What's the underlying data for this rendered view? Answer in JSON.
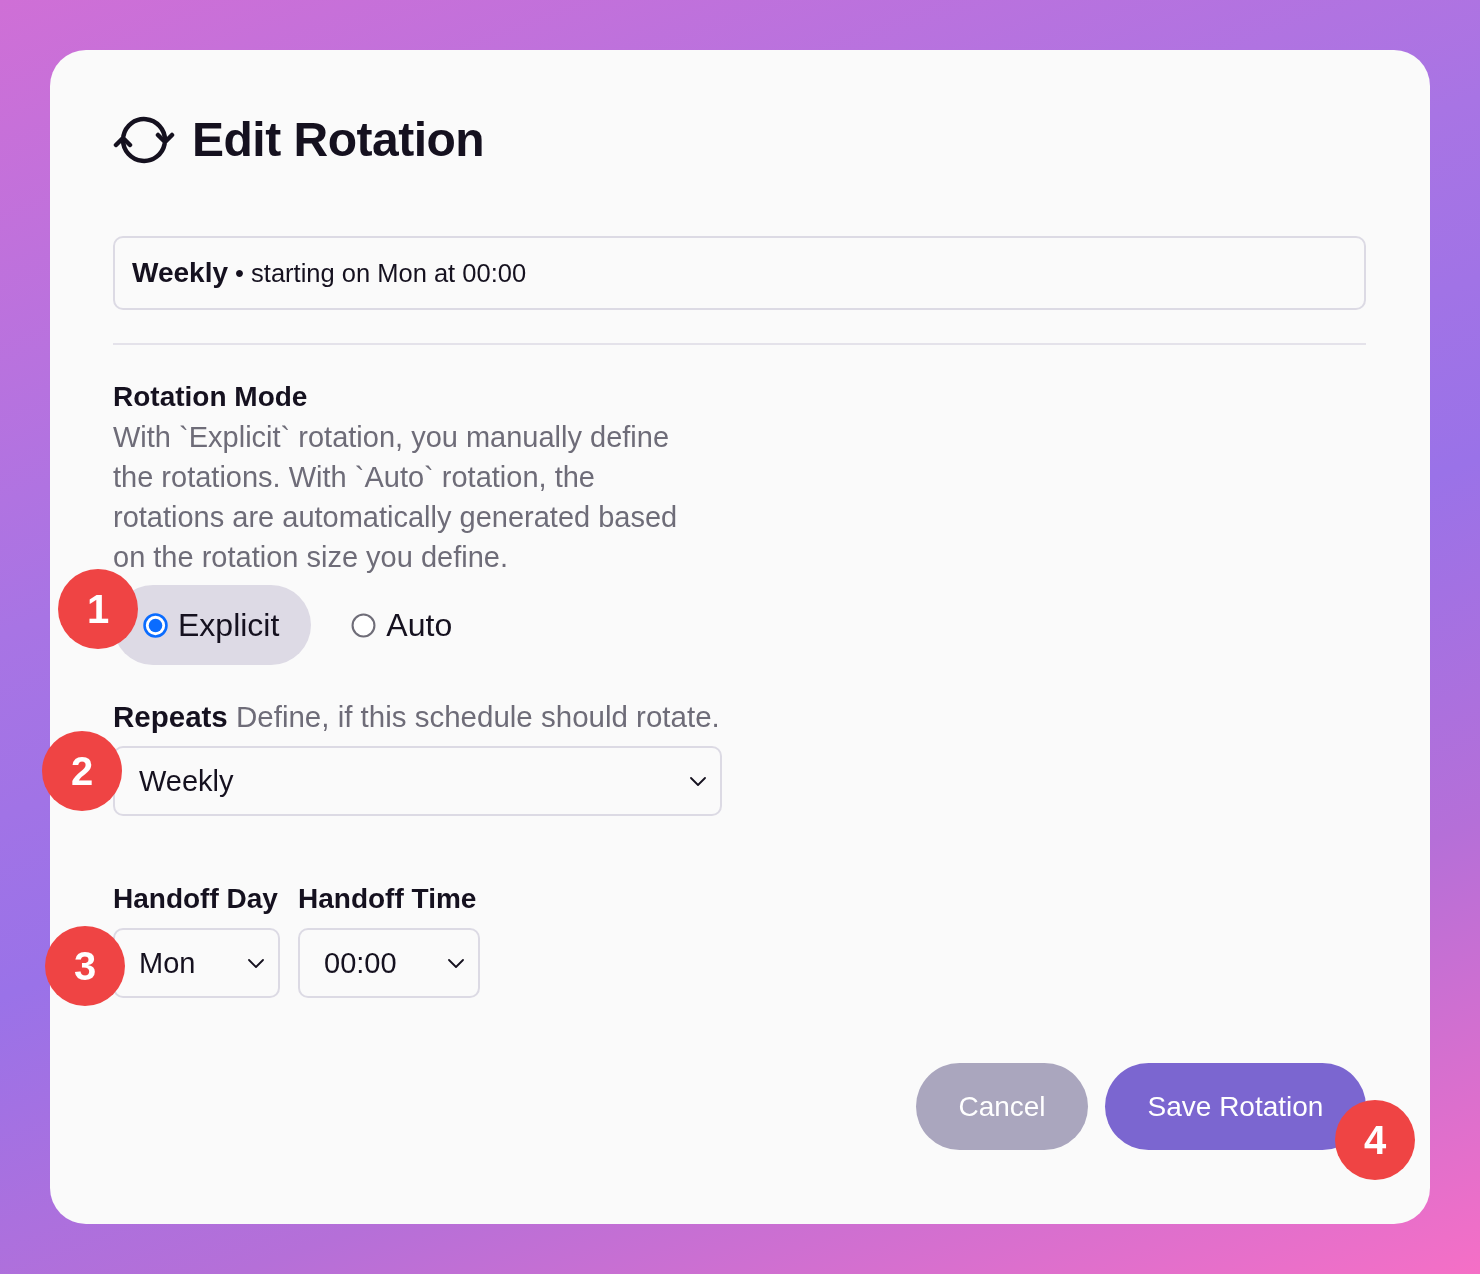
{
  "dialog": {
    "title": "Edit Rotation"
  },
  "summary": {
    "text": "**Weekly** • starting on Mon at 00:00"
  },
  "rotation_mode": {
    "label": "Rotation Mode",
    "description": "With `Explicit` rotation, you manually define the rotations. With `Auto` rotation, the rotations are automatically generated based on the rotation size you define.",
    "badge": "1",
    "options": [
      {
        "label": "Explicit",
        "selected": true
      },
      {
        "label": "Auto",
        "selected": false
      }
    ]
  },
  "repeats": {
    "label": "**Repeats** Define, if this schedule should rotate.",
    "value": "Weekly",
    "badge": "2"
  },
  "handoff": {
    "badge": "3",
    "fields": [
      {
        "label": "Handoff Day",
        "value": "Mon"
      },
      {
        "label": "Handoff Time",
        "value": "00:00"
      }
    ]
  },
  "buttons": [
    {
      "label": "Cancel",
      "kind": "secondary"
    },
    {
      "label": "Save Rotation",
      "kind": "primary",
      "badge": "4"
    }
  ]
}
